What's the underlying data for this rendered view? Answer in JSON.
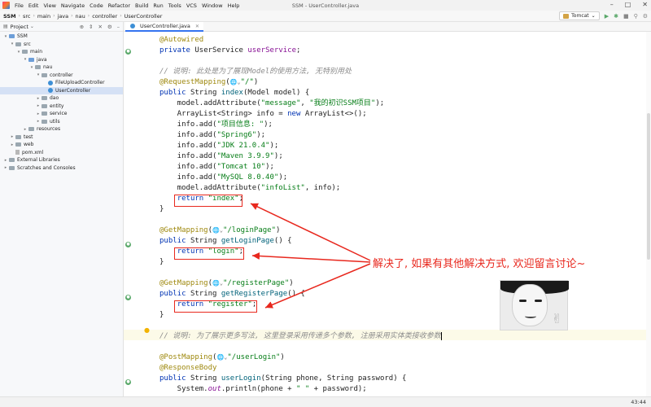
{
  "menu": {
    "items": [
      "File",
      "Edit",
      "View",
      "Navigate",
      "Code",
      "Refactor",
      "Build",
      "Run",
      "Tools",
      "VCS",
      "Window",
      "Help"
    ],
    "window_title": "SSM - UserController.java"
  },
  "navbar": {
    "breadcrumbs": [
      "SSM",
      "src",
      "main",
      "java",
      "nau",
      "controller",
      "UserController"
    ],
    "run_config": "Tomcat"
  },
  "project": {
    "title": "Project",
    "tree": [
      {
        "label": "SSM",
        "type": "folder-blue",
        "arrow": "v"
      },
      {
        "label": "src",
        "type": "folder",
        "arrow": "v"
      },
      {
        "label": "main",
        "type": "folder",
        "arrow": "v"
      },
      {
        "label": "java",
        "type": "folder-blue",
        "arrow": "v"
      },
      {
        "label": "nau",
        "type": "folder",
        "arrow": "v"
      },
      {
        "label": "controller",
        "type": "folder",
        "arrow": "v"
      },
      {
        "label": "FileUploadController",
        "type": "class",
        "arrow": ""
      },
      {
        "label": "UserController",
        "type": "class",
        "arrow": "",
        "selected": true
      },
      {
        "label": "dao",
        "type": "folder",
        "arrow": ">"
      },
      {
        "label": "entity",
        "type": "folder",
        "arrow": ">"
      },
      {
        "label": "service",
        "type": "folder",
        "arrow": ">"
      },
      {
        "label": "utils",
        "type": "folder",
        "arrow": ">"
      },
      {
        "label": "resources",
        "type": "folder",
        "arrow": ">"
      },
      {
        "label": "test",
        "type": "folder",
        "arrow": ">"
      },
      {
        "label": "web",
        "type": "folder",
        "arrow": ">"
      },
      {
        "label": "pom.xml",
        "type": "file",
        "arrow": ""
      },
      {
        "label": "External Libraries",
        "type": "folder",
        "arrow": ">"
      },
      {
        "label": "Scratches and Consoles",
        "type": "folder",
        "arrow": ">"
      }
    ]
  },
  "editor": {
    "tab": "UserController.java",
    "lines": [
      [
        [
          "an",
          "@Autowired"
        ]
      ],
      [
        [
          "kw",
          "private "
        ],
        [
          "",
          "UserService "
        ],
        [
          "fd",
          "userService"
        ],
        [
          "",
          ";"
        ]
      ],
      [
        [
          "",
          ""
        ]
      ],
      [
        [
          "cm",
          "// 说明: 此处是为了展现Model的使用方法, 无特别用处"
        ]
      ],
      [
        [
          "an",
          "@RequestMapping"
        ],
        [
          "",
          "("
        ],
        [
          "globe",
          "🌐⌄"
        ],
        [
          "st",
          "\"/\""
        ],
        [
          "",
          ")"
        ]
      ],
      [
        [
          "kw",
          "public "
        ],
        [
          "",
          "String "
        ],
        [
          "mt",
          "index"
        ],
        [
          "",
          "(Model model) {"
        ]
      ],
      [
        [
          "",
          "    model.addAttribute("
        ],
        [
          "st",
          "\"message\""
        ],
        [
          "",
          ", "
        ],
        [
          "st",
          "\"我的初识SSM项目\""
        ],
        [
          "",
          ");"
        ]
      ],
      [
        [
          "",
          "    ArrayList<String> info = "
        ],
        [
          "kw",
          "new "
        ],
        [
          "",
          "ArrayList<>();"
        ]
      ],
      [
        [
          "",
          "    info.add("
        ],
        [
          "st",
          "\"项目信息: \""
        ],
        [
          "",
          ");"
        ]
      ],
      [
        [
          "",
          "    info.add("
        ],
        [
          "st",
          "\"Spring6\""
        ],
        [
          "",
          ");"
        ]
      ],
      [
        [
          "",
          "    info.add("
        ],
        [
          "st",
          "\"JDK 21.0.4\""
        ],
        [
          "",
          ");"
        ]
      ],
      [
        [
          "",
          "    info.add("
        ],
        [
          "st",
          "\"Maven 3.9.9\""
        ],
        [
          "",
          ");"
        ]
      ],
      [
        [
          "",
          "    info.add("
        ],
        [
          "st",
          "\"Tomcat 10\""
        ],
        [
          "",
          ");"
        ]
      ],
      [
        [
          "",
          "    info.add("
        ],
        [
          "st",
          "\"MySQL 8.0.40\""
        ],
        [
          "",
          ");"
        ]
      ],
      [
        [
          "",
          "    model.addAttribute("
        ],
        [
          "st",
          "\"infoList\""
        ],
        [
          "",
          ", info);"
        ]
      ],
      [
        [
          "",
          "    "
        ],
        [
          "kw",
          "return "
        ],
        [
          "st",
          "\"index\""
        ],
        [
          "",
          ";"
        ]
      ],
      [
        [
          "",
          "}"
        ]
      ],
      [
        [
          "",
          ""
        ]
      ],
      [
        [
          "an",
          "@GetMapping"
        ],
        [
          "",
          "("
        ],
        [
          "globe",
          "🌐⌄"
        ],
        [
          "st",
          "\"/loginPage\""
        ],
        [
          "",
          ")"
        ]
      ],
      [
        [
          "kw",
          "public "
        ],
        [
          "",
          "String "
        ],
        [
          "mt",
          "getLoginPage"
        ],
        [
          "",
          "() {"
        ]
      ],
      [
        [
          "",
          "    "
        ],
        [
          "kw",
          "return "
        ],
        [
          "st",
          "\"login\""
        ],
        [
          "",
          ";"
        ]
      ],
      [
        [
          "",
          "}"
        ]
      ],
      [
        [
          "",
          ""
        ]
      ],
      [
        [
          "an",
          "@GetMapping"
        ],
        [
          "",
          "("
        ],
        [
          "globe",
          "🌐⌄"
        ],
        [
          "st",
          "\"/registerPage\""
        ],
        [
          "",
          ")"
        ]
      ],
      [
        [
          "kw",
          "public "
        ],
        [
          "",
          "String "
        ],
        [
          "mt",
          "getRegisterPage"
        ],
        [
          "",
          "() {"
        ]
      ],
      [
        [
          "",
          "    "
        ],
        [
          "kw",
          "return "
        ],
        [
          "st",
          "\"register\""
        ],
        [
          "",
          ";"
        ]
      ],
      [
        [
          "",
          "}"
        ]
      ],
      [
        [
          "",
          ""
        ]
      ],
      [
        [
          "cm",
          "// 说明: 为了展示更多写法, 这里登录采用传递多个参数, 注册采用实体类接收参数"
        ]
      ],
      [
        [
          "",
          ""
        ]
      ],
      [
        [
          "an",
          "@PostMapping"
        ],
        [
          "",
          "("
        ],
        [
          "globe",
          "🌐⌄"
        ],
        [
          "st",
          "\"/userLogin\""
        ],
        [
          "",
          ")"
        ]
      ],
      [
        [
          "an",
          "@ResponseBody"
        ]
      ],
      [
        [
          "kw",
          "public "
        ],
        [
          "",
          "String "
        ],
        [
          "mt",
          "userLogin"
        ],
        [
          "",
          "(String phone, String password) {"
        ]
      ],
      [
        [
          "",
          "    System."
        ],
        [
          "it",
          "out"
        ],
        [
          "",
          ".println(phone + "
        ],
        [
          "st",
          "\" \""
        ],
        [
          "",
          " + password);"
        ]
      ]
    ]
  },
  "annotation": {
    "note": "解决了, 如果有其他解决方式, 欢迎留言讨论~",
    "color": "#e8281e"
  },
  "status": {
    "caret": "43:44"
  }
}
